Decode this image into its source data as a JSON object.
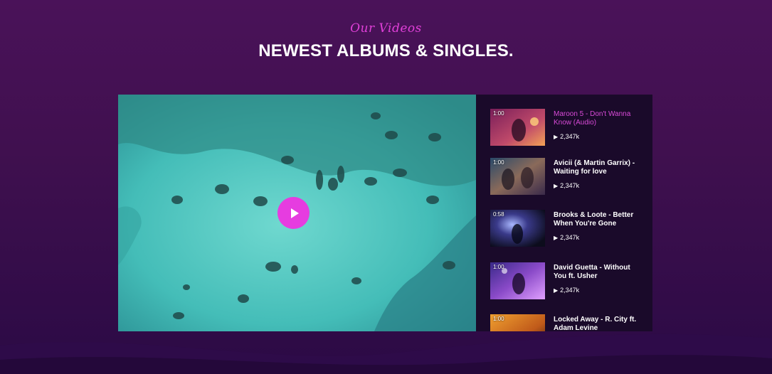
{
  "section": {
    "subtitle": "Our Videos",
    "title": "NEWEST ALBUMS & SINGLES."
  },
  "player": {
    "play_icon": "play-icon",
    "accent_color": "#e63ce0"
  },
  "playlist": {
    "items": [
      {
        "duration": "1:00",
        "title": "Maroon 5 - Don't Wanna Know (Audio)",
        "views": "2,347k",
        "active": true
      },
      {
        "duration": "1:00",
        "title": "Avicii (& Martin Garrix) - Waiting for love",
        "views": "2,347k",
        "active": false
      },
      {
        "duration": "0:58",
        "title": "Brooks & Loote - Better When You're Gone",
        "views": "2,347k",
        "active": false
      },
      {
        "duration": "1:00",
        "title": "David Guetta - Without You ft. Usher",
        "views": "2,347k",
        "active": false
      },
      {
        "duration": "1:00",
        "title": "Locked Away - R. City ft. Adam Levine",
        "views": "",
        "active": false
      }
    ]
  },
  "colors": {
    "background": "#40104f",
    "playlist_bg": "#1a0a2a",
    "active_title": "#d94ad8"
  }
}
